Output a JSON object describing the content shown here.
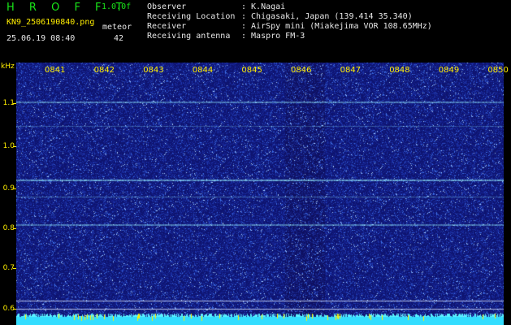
{
  "app": {
    "logo_text": "H R O F F T",
    "version": "1.0.0f",
    "filename": "KN9_2506190840.png",
    "station_label": "meteor",
    "timestamp": "25.06.19 08:40",
    "count": "42"
  },
  "info": {
    "observer_label": "Observer",
    "observer_value": ": K.Nagai",
    "location_label": "Receiving Location",
    "location_value": ": Chigasaki, Japan (139.414 35.340)",
    "receiver_label": "Receiver",
    "receiver_value": ": AirSpy mini (Miakejima VOR 108.65MHz)",
    "antenna_label": "Receiving antenna",
    "antenna_value": ": Maspro FM-3"
  },
  "axis": {
    "y_unit": "kHz",
    "y_ticks": [
      "1.1",
      "1.0",
      "0.9",
      "0.8",
      "0.7",
      "0.6"
    ],
    "x_ticks": [
      "0841",
      "0842",
      "0843",
      "0844",
      "0845",
      "0846",
      "0847",
      "0848",
      "0849",
      "0850"
    ]
  },
  "colors": {
    "background": "#000000",
    "plot_base": "#10157a",
    "label_yellow": "#ffee00",
    "logo_green": "#19e619",
    "trace_cyan": "#8ff4ff"
  }
}
